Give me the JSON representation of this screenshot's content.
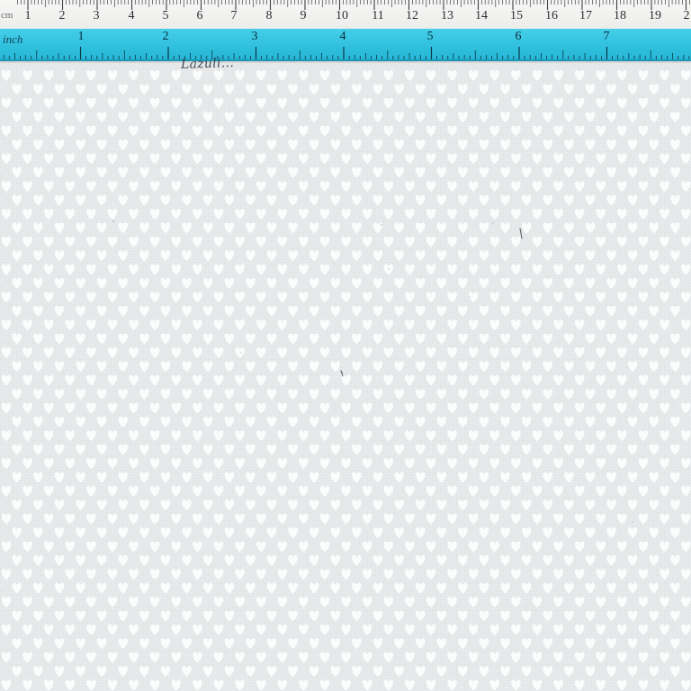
{
  "image": {
    "subject": "gray-fabric-with-white-hearts",
    "background_color": "#e6e8e9",
    "motif": "heart-icon",
    "motif_color": "#fbfcfc"
  },
  "rulers": {
    "cm": {
      "unit_label": "cm",
      "numbers": [
        "1",
        "2",
        "3",
        "4",
        "5",
        "6",
        "7",
        "8",
        "9",
        "10",
        "11",
        "12",
        "13",
        "14",
        "15",
        "16",
        "17",
        "18",
        "19",
        "2"
      ],
      "color": "#f2f2f0"
    },
    "inch": {
      "unit_label": "inch",
      "numbers": [
        "1",
        "2",
        "3",
        "4",
        "5",
        "6",
        "7"
      ],
      "color": "#33c4e1",
      "handwriting": "Lazuli..."
    }
  }
}
